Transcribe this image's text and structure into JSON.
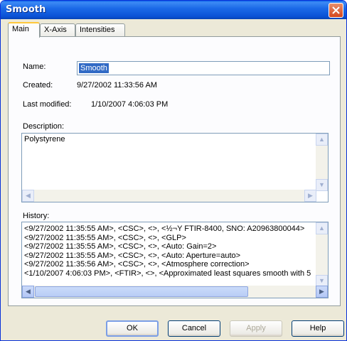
{
  "window": {
    "title": "Smooth"
  },
  "tabs": [
    {
      "label": "Main"
    },
    {
      "label": "X-Axis"
    },
    {
      "label": "Intensities"
    }
  ],
  "fields": {
    "name_label": "Name:",
    "name_value": "Smooth",
    "created_label": "Created:",
    "created_value": "9/27/2002 11:33:56 AM",
    "modified_label": "Last modified:",
    "modified_value": "1/10/2007 4:06:03 PM",
    "description_label": "Description:",
    "description_value": "Polystyrene",
    "history_label": "History:"
  },
  "history": [
    "<9/27/2002 11:35:55 AM>, <CSC>, <>, <½¬Y FTIR-8400, SNO: A20963800044>",
    "<9/27/2002 11:35:55 AM>, <CSC>, <>, <GLP>",
    "<9/27/2002 11:35:55 AM>, <CSC>, <>, <Auto: Gain=2>",
    "<9/27/2002 11:35:55 AM>, <CSC>, <>, <Auto: Aperture=auto>",
    "<9/27/2002 11:35:56 AM>, <CSC>, <>, <Atmosphere correction>",
    "<1/10/2007 4:06:03 PM>, <FTIR>, <>, <Approximated least squares smooth with 5"
  ],
  "buttons": {
    "ok": "OK",
    "cancel": "Cancel",
    "apply": "Apply",
    "help": "Help"
  }
}
